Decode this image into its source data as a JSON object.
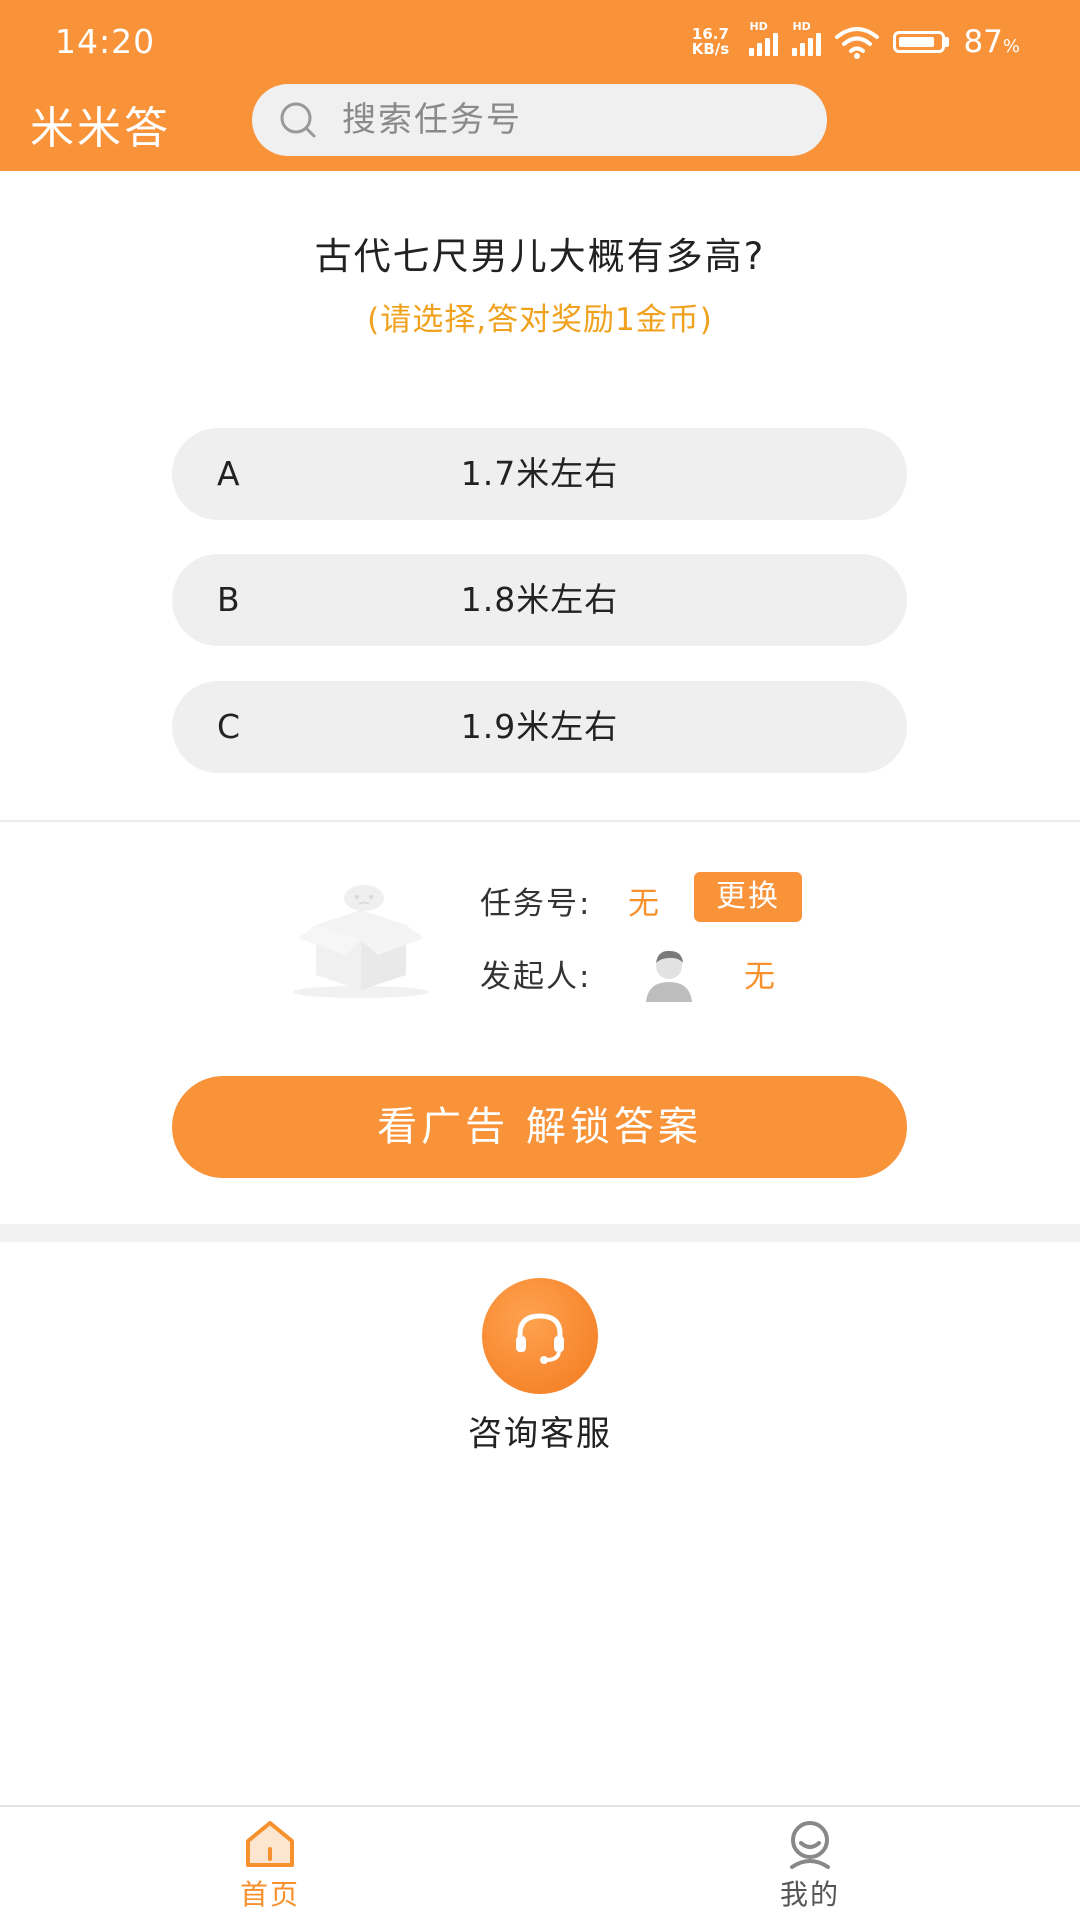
{
  "status_bar": {
    "time": "14:20",
    "net_speed_top": "16.7",
    "net_speed_bottom": "KB/s",
    "hd_1": "HD",
    "hd_2": "HD",
    "battery_level": 0.87,
    "battery_percent": "87",
    "battery_unit": "%"
  },
  "header": {
    "app_title": "米米答",
    "search_placeholder": "搜索任务号",
    "search_value": ""
  },
  "question": {
    "text": "古代七尺男儿大概有多高?",
    "hint": "(请选择,答对奖励1金币)"
  },
  "options": [
    {
      "letter": "A",
      "text": "1.7米左右"
    },
    {
      "letter": "B",
      "text": "1.8米左右"
    },
    {
      "letter": "C",
      "text": "1.9米左右"
    }
  ],
  "task": {
    "task_no_label": "任务号:",
    "task_no_value": "无",
    "change_label": "更换",
    "initiator_label": "发起人:",
    "initiator_value": "无"
  },
  "unlock_button": "看广告 解锁答案",
  "customer_service": "咨询客服",
  "bottom_nav": {
    "home": "首页",
    "mine": "我的"
  },
  "colors": {
    "accent": "#f9933a",
    "hint": "#f0a21f",
    "option_bg": "#efefef"
  }
}
